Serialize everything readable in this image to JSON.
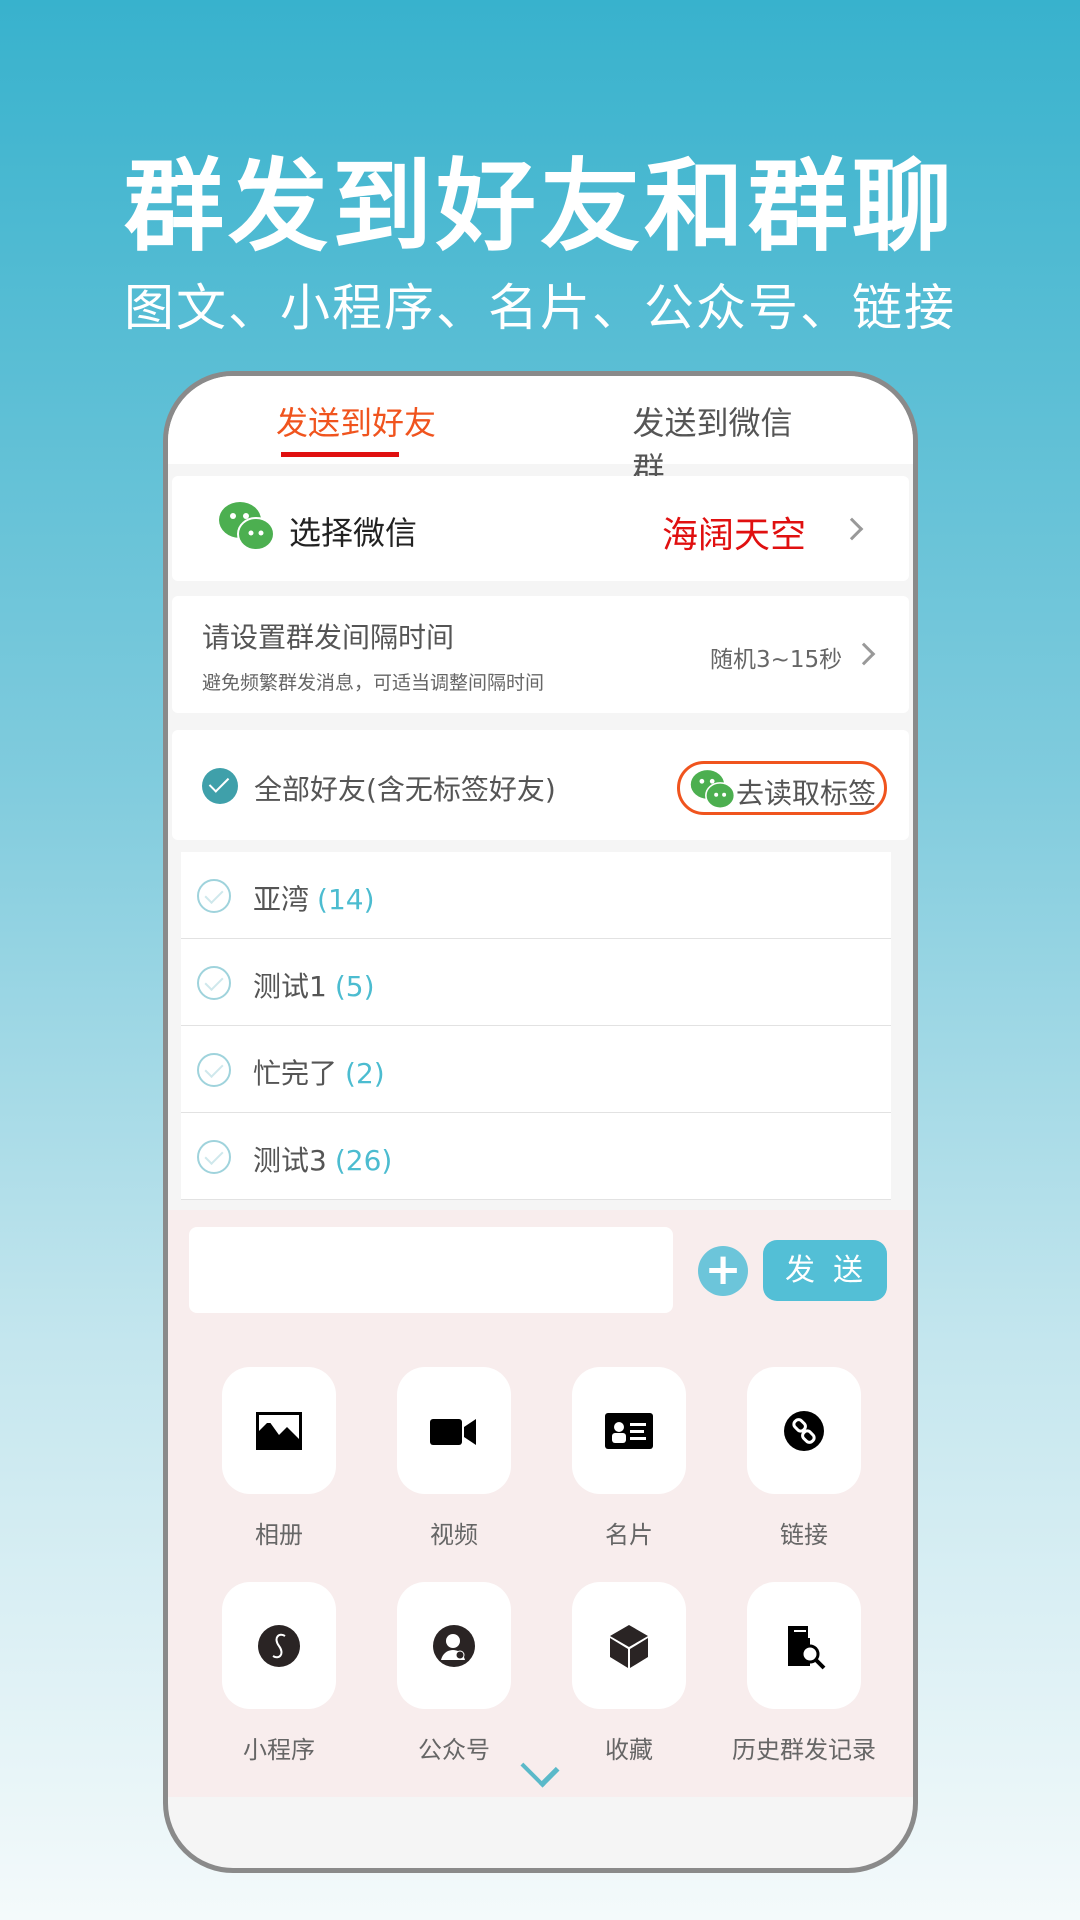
{
  "hero": {
    "title": "群发到好友和群聊",
    "subtitle": "图文、小程序、名片、公众号、链接"
  },
  "tabs": [
    {
      "label": "发送到好友",
      "active": true
    },
    {
      "label": "发送到微信群",
      "active": false
    }
  ],
  "select_wechat": {
    "label": "选择微信",
    "value": "海阔天空"
  },
  "interval": {
    "title": "请设置群发间隔时间",
    "hint": "避免频繁群发消息，可适当调整间隔时间",
    "value": "随机3~15秒"
  },
  "all_friends": {
    "label": "全部好友(含无标签好友)",
    "checked": true,
    "read_tags_label": "去读取标签"
  },
  "tags": [
    {
      "name": "亚湾",
      "count": "(14)"
    },
    {
      "name": "测试1",
      "count": "(5)"
    },
    {
      "name": "忙完了",
      "count": "(2)"
    },
    {
      "name": "测试3",
      "count": "(26)"
    }
  ],
  "composer": {
    "input_value": "",
    "send_label": "发送",
    "plus_icon": "plus-icon"
  },
  "actions": [
    {
      "label": "相册",
      "icon": "image-icon"
    },
    {
      "label": "视频",
      "icon": "video-icon"
    },
    {
      "label": "名片",
      "icon": "id-card-icon"
    },
    {
      "label": "链接",
      "icon": "link-icon"
    },
    {
      "label": "小程序",
      "icon": "mini-program-icon"
    },
    {
      "label": "公众号",
      "icon": "official-account-icon"
    },
    {
      "label": "收藏",
      "icon": "cube-icon"
    },
    {
      "label": "历史群发记录",
      "icon": "history-search-icon"
    }
  ],
  "colors": {
    "accent": "#53bfd6",
    "active_tab": "#f0541e",
    "wechat_green": "#4caf50",
    "highlight_red": "#e01010"
  }
}
